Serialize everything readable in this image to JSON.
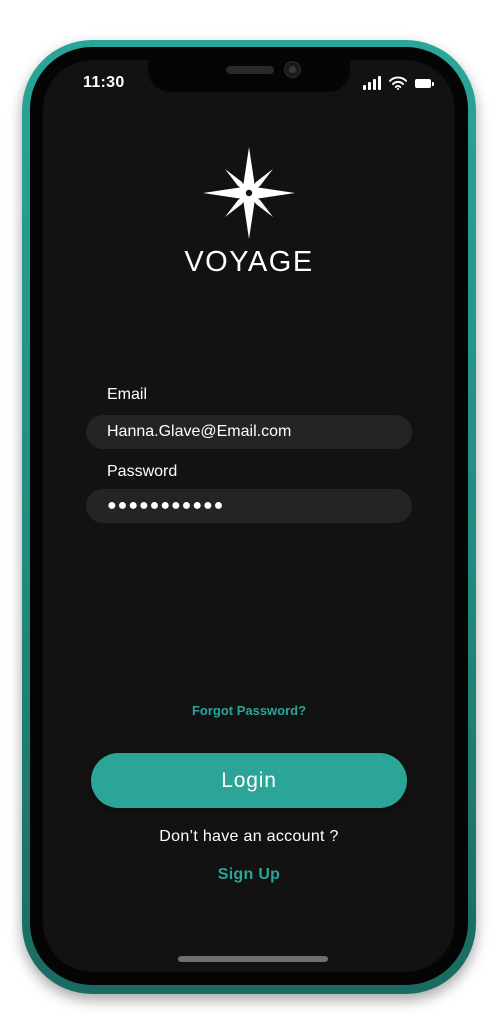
{
  "status_bar": {
    "time": "11:30",
    "icons": [
      "signal-icon",
      "wifi-icon",
      "battery-icon"
    ]
  },
  "brand": {
    "logo_icon": "compass-star-icon",
    "app_name": "VOYAGE"
  },
  "form": {
    "email_label": "Email",
    "email_value": "Hanna.Glave@Email.com",
    "password_label": "Password",
    "password_value": "●●●●●●●●●●●"
  },
  "actions": {
    "forgot_password": "Forgot Password?",
    "login_label": "Login",
    "account_prompt": "Don’t have an account ?",
    "signup_label": "Sign Up"
  },
  "colors": {
    "accent": "#2aa597",
    "background": "#121212",
    "field_background": "#242424",
    "text": "#ffffff"
  }
}
